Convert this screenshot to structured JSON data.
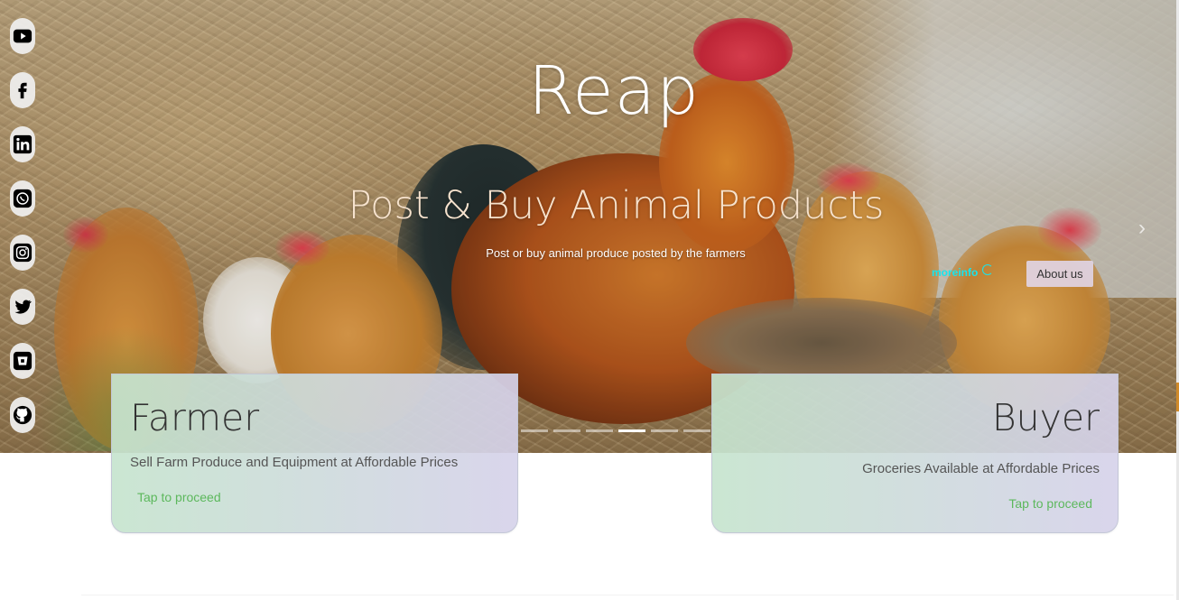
{
  "hero": {
    "title": "Reap",
    "subtitle": "Post & Buy Animal Products",
    "description": "Post or buy animal produce posted by the farmers",
    "moreinfo_label": "moreinfo",
    "about_label": "About us",
    "slides_count": 6,
    "active_slide": 4
  },
  "social": [
    {
      "name": "youtube-icon"
    },
    {
      "name": "facebook-icon"
    },
    {
      "name": "linkedin-icon"
    },
    {
      "name": "whatsapp-icon"
    },
    {
      "name": "instagram-icon"
    },
    {
      "name": "twitter-icon"
    },
    {
      "name": "bitbucket-icon"
    },
    {
      "name": "github-icon"
    }
  ],
  "cards": {
    "farmer": {
      "title": "Farmer",
      "description": "Sell Farm Produce and Equipment at Affordable Prices",
      "link": "Tap to proceed"
    },
    "buyer": {
      "title": "Buyer",
      "description": "Groceries Available at Affordable Prices",
      "link": "Tap to proceed"
    }
  },
  "colors": {
    "link_green": "#5cb85c",
    "moreinfo_cyan": "#16e6ee",
    "about_bg": "#e1d7ec"
  }
}
